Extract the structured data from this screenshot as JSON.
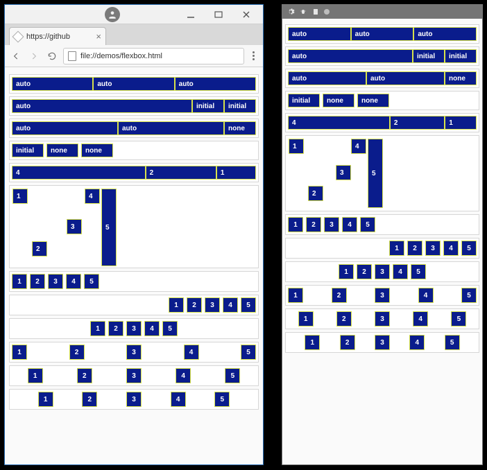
{
  "browser": {
    "tab_title": "https://github",
    "url": "file://demos/flexbox.html"
  },
  "labels": {
    "auto": "auto",
    "initial": "initial",
    "none": "none"
  },
  "rows": {
    "auto3": [
      "auto",
      "auto",
      "auto"
    ],
    "autoI": [
      "auto",
      "initial",
      "initial"
    ],
    "autoN": [
      "auto",
      "auto",
      "none"
    ],
    "inn": [
      "initial",
      "none",
      "none"
    ],
    "r421": [
      "4",
      "2",
      "1"
    ],
    "scatter": [
      "1",
      "2",
      "3",
      "4",
      "5"
    ],
    "five": [
      "1",
      "2",
      "3",
      "4",
      "5"
    ]
  }
}
